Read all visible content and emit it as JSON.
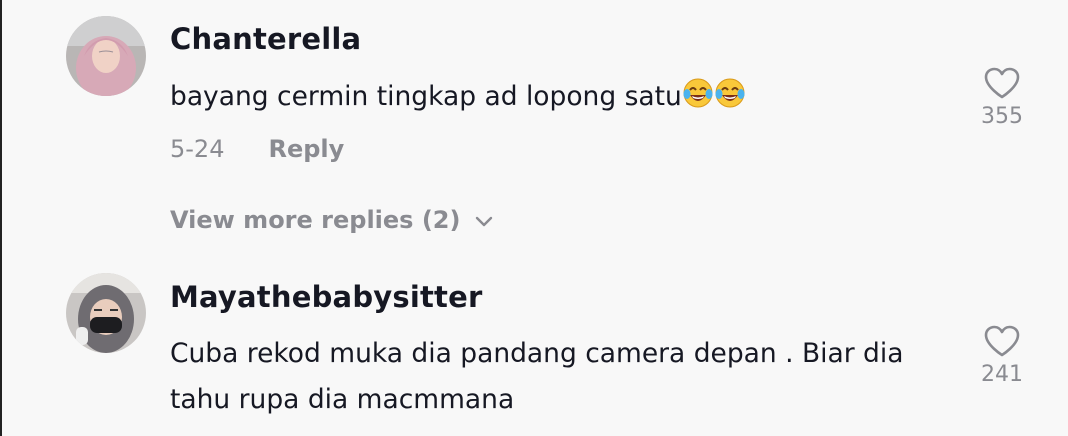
{
  "comments": [
    {
      "username": "Chanterella",
      "text": "bayang cermin tingkap ad lopong satu",
      "emojis": [
        "face-with-tears-of-joy",
        "face-with-tears-of-joy"
      ],
      "date": "5-24",
      "reply_label": "Reply",
      "likes": "355",
      "view_more": "View more replies (2)"
    },
    {
      "username": "Mayathebabysitter",
      "text_line1": "Cuba rekod muka dia pandang camera depan . Biar dia",
      "text_line2": "tahu rupa dia macmmana",
      "likes": "241"
    }
  ]
}
